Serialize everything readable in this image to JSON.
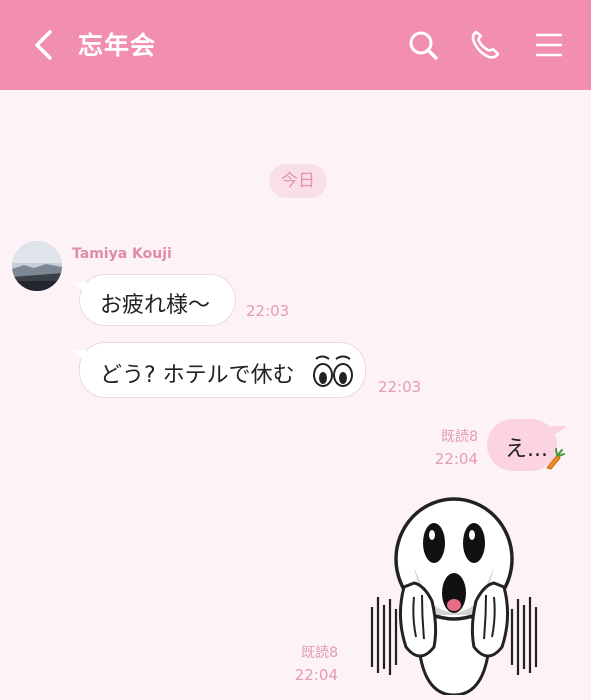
{
  "header": {
    "title": "忘年会",
    "icons": [
      "back-icon",
      "search-icon",
      "phone-icon",
      "menu-icon"
    ],
    "color": "#f28fb0"
  },
  "chat": {
    "date_label": "今日",
    "incoming": {
      "sender": "Tamiya Kouji",
      "messages": [
        {
          "text": "お疲れ様〜",
          "time": "22:03"
        },
        {
          "text": "どう? ホテルで休む",
          "time": "22:03"
        }
      ]
    },
    "outgoing": [
      {
        "text": "え...",
        "read": "既読8",
        "time": "22:04"
      },
      {
        "type": "sticker",
        "read": "既読8",
        "time": "22:04"
      }
    ]
  },
  "colors": {
    "background": "#fdf2f5",
    "accent_pink": "#e792b0",
    "outgoing_bubble": "#fbd3e1"
  }
}
